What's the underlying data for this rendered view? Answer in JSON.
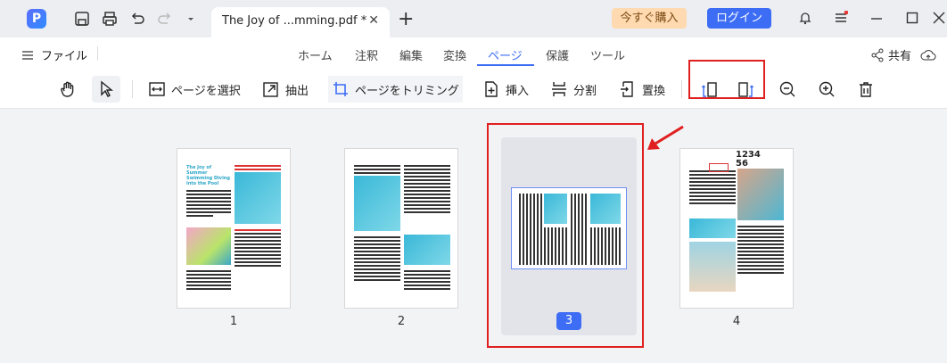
{
  "titlebar": {
    "tab_title": "The Joy of ...mming.pdf *",
    "tab_close": "✕",
    "new_tab": "+",
    "buy_label": "今すぐ購入",
    "login_label": "ログイン",
    "logo_letter": "P"
  },
  "menubar": {
    "file_label": "ファイル",
    "items": [
      "ホーム",
      "注釈",
      "編集",
      "変換",
      "ページ",
      "保護",
      "ツール"
    ],
    "active_item": "ページ",
    "share_label": "共有"
  },
  "toolbar": {
    "select_page": "ページを選択",
    "extract": "抽出",
    "trim_page": "ページをトリミング",
    "insert": "挿入",
    "split": "分割",
    "replace": "置換"
  },
  "pages": [
    {
      "number": "1",
      "title": "The Joy of Summer Swimming Diving into the Pool"
    },
    {
      "number": "2"
    },
    {
      "number": "3",
      "selected": true
    },
    {
      "number": "4",
      "header": "1234\n56"
    }
  ],
  "colors": {
    "accent": "#3d6df5",
    "highlight_red": "#e02020",
    "buy_bg": "#ffd9b0"
  }
}
